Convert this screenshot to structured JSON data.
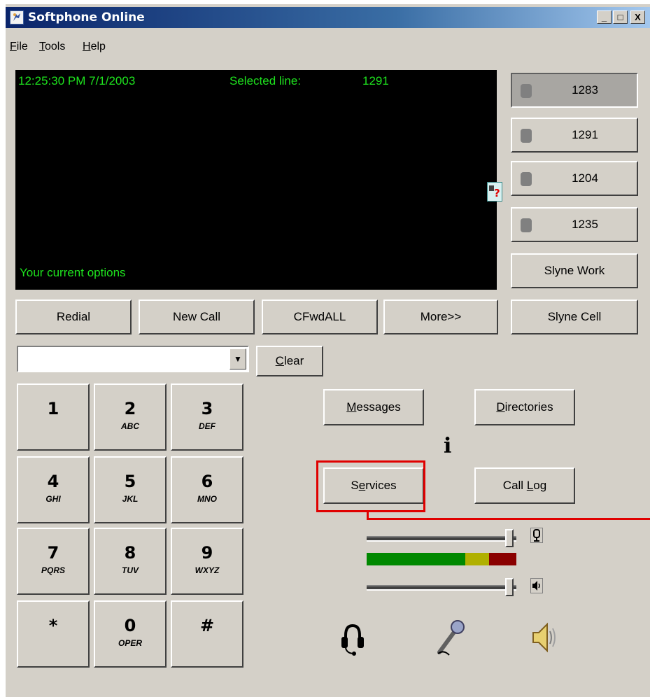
{
  "window": {
    "title": "Softphone Online",
    "minimize_glyph": "_",
    "maximize_glyph": "□",
    "close_glyph": "X"
  },
  "menu": {
    "items": [
      {
        "label": "File",
        "accel": "F",
        "rest": "ile"
      },
      {
        "label": "Tools",
        "accel": "T",
        "rest": "ools"
      },
      {
        "label": "Help",
        "accel": "H",
        "rest": "elp"
      }
    ]
  },
  "display": {
    "datetime": "12:25:30 PM 7/1/2003",
    "selected_line_label": "Selected line:",
    "selected_line_value": "1291",
    "options_text": "Your current options"
  },
  "lines": [
    {
      "number": "1283",
      "active": true
    },
    {
      "number": "1291",
      "active": false
    },
    {
      "number": "1204",
      "active": false
    },
    {
      "number": "1235",
      "active": false
    }
  ],
  "speed_dials": [
    "Slyne Work",
    "Slyne Cell"
  ],
  "softkeys": [
    "Redial",
    "New Call",
    "CFwdALL",
    "More>>"
  ],
  "dial_input": {
    "value": ""
  },
  "clear_button": {
    "accel": "C",
    "rest": "lear"
  },
  "keypad": [
    {
      "num": "1",
      "sub": ""
    },
    {
      "num": "2",
      "sub": "ABC"
    },
    {
      "num": "3",
      "sub": "DEF"
    },
    {
      "num": "4",
      "sub": "GHI"
    },
    {
      "num": "5",
      "sub": "JKL"
    },
    {
      "num": "6",
      "sub": "MNO"
    },
    {
      "num": "7",
      "sub": "PQRS"
    },
    {
      "num": "8",
      "sub": "TUV"
    },
    {
      "num": "9",
      "sub": "WXYZ"
    },
    {
      "num": "*",
      "sub": ""
    },
    {
      "num": "0",
      "sub": "OPER"
    },
    {
      "num": "#",
      "sub": ""
    }
  ],
  "feature_buttons": {
    "messages": {
      "accel": "M",
      "rest": "essages"
    },
    "directories": {
      "accel": "D",
      "rest": "irectories"
    },
    "services": {
      "pre": "S",
      "accel": "e",
      "rest": "rvices"
    },
    "call_log": {
      "pre": "Call ",
      "accel": "L",
      "rest": "og"
    },
    "info_glyph": "i"
  },
  "audio": {
    "mic_volume": 0.98,
    "speaker_volume": 0.98,
    "level_green": 0.66,
    "level_yellow": 0.16,
    "level_red": 0.18
  },
  "icons": [
    "headset-icon",
    "microphone-icon",
    "speaker-icon"
  ],
  "colors": {
    "display_text": "#1ee31e",
    "highlight": "#e00000",
    "title_start": "#0a246a"
  }
}
